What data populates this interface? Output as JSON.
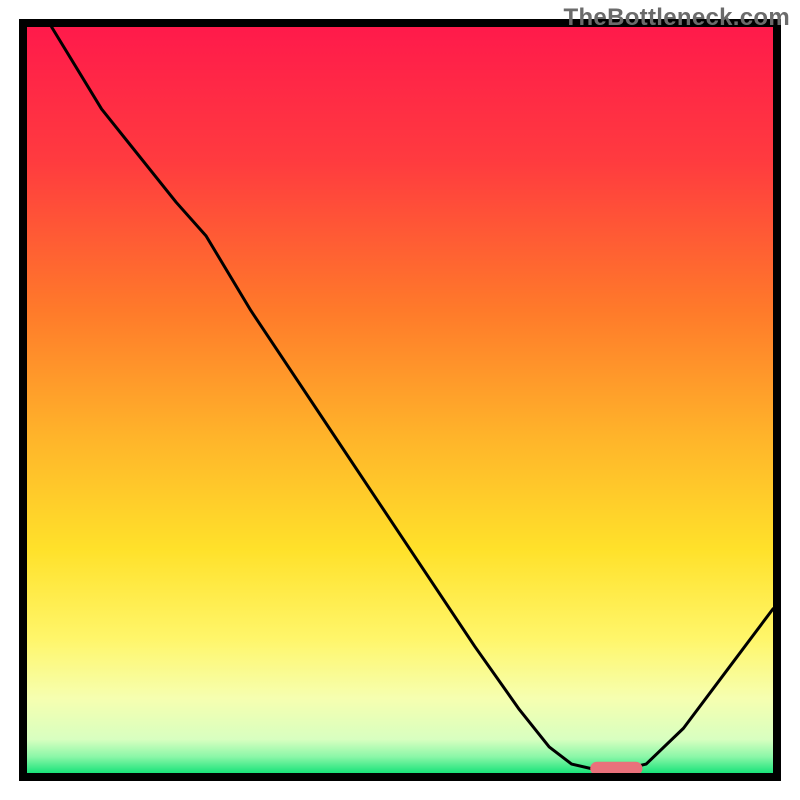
{
  "watermark": "TheBottleneck.com",
  "chart_data": {
    "type": "line",
    "xlim": [
      0,
      100
    ],
    "ylim": [
      0,
      100
    ],
    "title": "",
    "xlabel": "",
    "ylabel": "",
    "gradient_stops": [
      {
        "offset": 0.0,
        "color": "#ff1a4b"
      },
      {
        "offset": 0.18,
        "color": "#ff3b3f"
      },
      {
        "offset": 0.38,
        "color": "#ff7a2a"
      },
      {
        "offset": 0.55,
        "color": "#ffb42a"
      },
      {
        "offset": 0.7,
        "color": "#ffe12a"
      },
      {
        "offset": 0.82,
        "color": "#fff66a"
      },
      {
        "offset": 0.9,
        "color": "#f6ffb0"
      },
      {
        "offset": 0.955,
        "color": "#d8ffc0"
      },
      {
        "offset": 0.978,
        "color": "#8cf7a8"
      },
      {
        "offset": 1.0,
        "color": "#19e37a"
      }
    ],
    "curve_xy": [
      [
        3.3,
        100.0
      ],
      [
        10.0,
        89.0
      ],
      [
        20.0,
        76.5
      ],
      [
        24.0,
        72.0
      ],
      [
        30.0,
        62.0
      ],
      [
        40.0,
        47.0
      ],
      [
        50.0,
        32.0
      ],
      [
        60.0,
        17.0
      ],
      [
        66.0,
        8.5
      ],
      [
        70.0,
        3.5
      ],
      [
        73.0,
        1.2
      ],
      [
        76.0,
        0.5
      ],
      [
        80.0,
        0.5
      ],
      [
        83.0,
        1.2
      ],
      [
        88.0,
        6.0
      ],
      [
        94.0,
        14.0
      ],
      [
        100.0,
        22.0
      ]
    ],
    "marker": {
      "x0": 75.5,
      "x1": 82.5,
      "y": 0.6,
      "color": "#e9717b",
      "radius": 1.0
    }
  }
}
